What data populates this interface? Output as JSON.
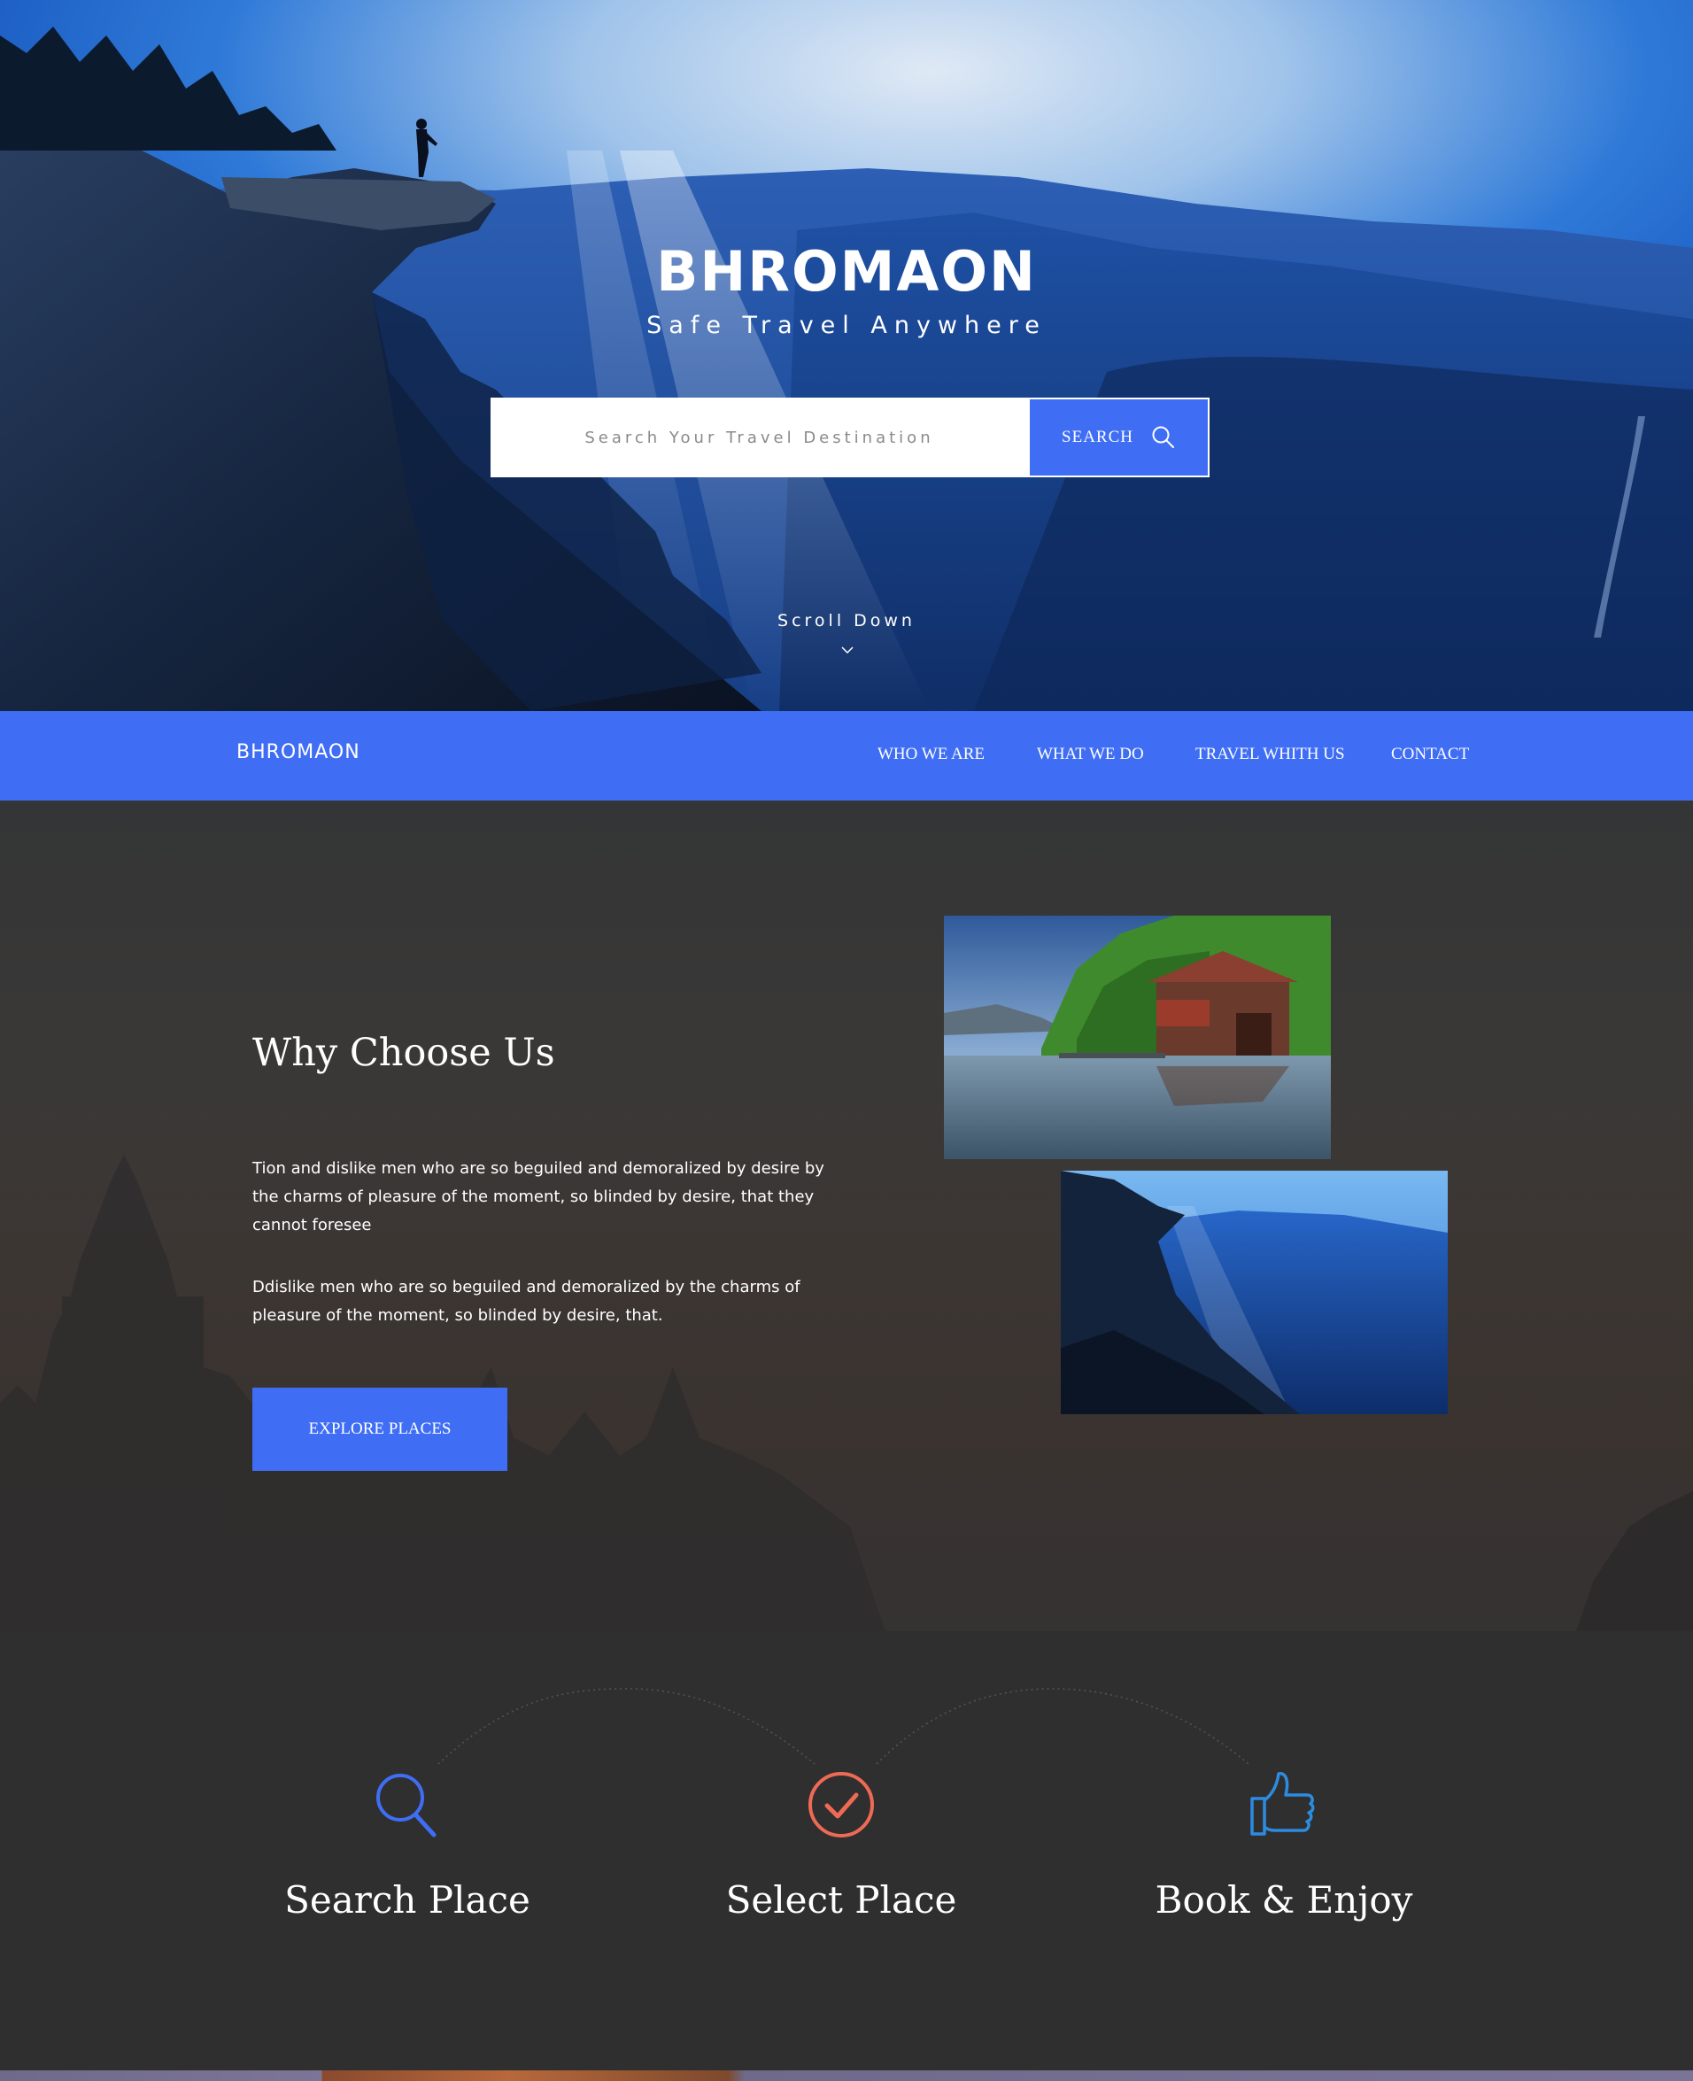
{
  "hero": {
    "title": "BHROMAON",
    "subtitle": "Safe Travel Anywhere",
    "search_placeholder": "Search Your Travel Destination",
    "search_button": "SEARCH",
    "scroll_label": "Scroll Down"
  },
  "nav": {
    "brand": "BHROMAON",
    "links": [
      "WHO WE ARE",
      "WHAT WE DO",
      "TRAVEL WHITH US",
      "CONTACT"
    ]
  },
  "why": {
    "title": "Why Choose Us",
    "paragraph1": "Tion and dislike men who are so beguiled and demoralized by desire by the charms of pleasure of the moment, so blinded by desire, that they cannot foresee",
    "paragraph2": "Ddislike men who are so beguiled and demoralized by the charms of pleasure of the moment, so blinded by desire, that.",
    "button": "EXPLORE PLACES"
  },
  "steps": [
    {
      "title": "Search Place",
      "icon": "search-icon",
      "color": "#3f6ef5"
    },
    {
      "title": "Select Place",
      "icon": "check-circle-icon",
      "color": "#ef6a55"
    },
    {
      "title": "Book & Enjoy",
      "icon": "thumbs-up-icon",
      "color": "#2d8be0"
    }
  ],
  "colors": {
    "accent": "#3f6ef5",
    "dark_bg": "#2f2f2f"
  }
}
